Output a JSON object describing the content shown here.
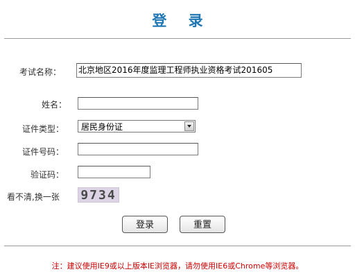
{
  "page": {
    "title": "登 录"
  },
  "form": {
    "exam_name_label": "考试名称：",
    "exam_name_value": "北京地区2016年度监理工程师执业资格考试201605",
    "name_label": "姓名：",
    "name_value": "",
    "id_type_label": "证件类型：",
    "id_type_value": "居民身份证",
    "id_number_label": "证件号码：",
    "id_number_value": "",
    "captcha_label": "验证码：",
    "captcha_value": "",
    "refresh_label": "看不清,换一张",
    "captcha_text": "9734"
  },
  "buttons": {
    "login": "登录",
    "reset": "重置"
  },
  "footer": {
    "note": "注：建议使用IE9或以上版本IE浏览器，请勿使用IE6或Chrome等浏览器。"
  },
  "colors": {
    "title": "#1f78b4",
    "note": "#cc0000"
  }
}
